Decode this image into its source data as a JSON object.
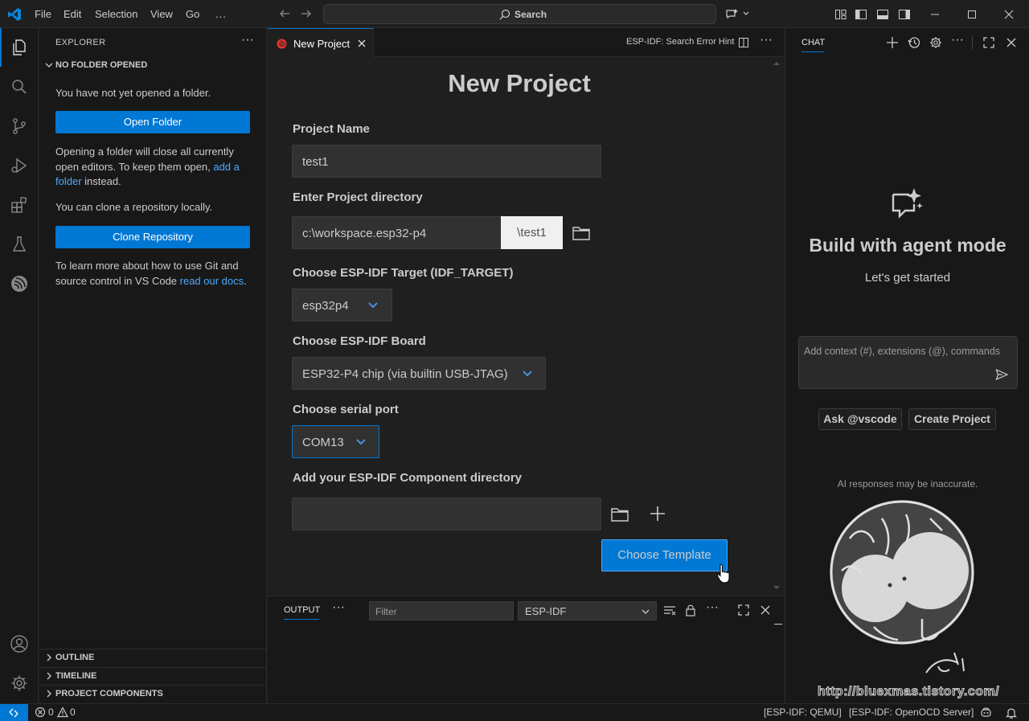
{
  "menu": [
    "File",
    "Edit",
    "Selection",
    "View",
    "Go",
    "..."
  ],
  "search_label": "Search",
  "sidebar": {
    "title": "EXPLORER",
    "section": "NO FOLDER OPENED",
    "intro": "You have not yet opened a folder.",
    "open_folder": "Open Folder",
    "note_before": "Opening a folder will close all currently open editors. To keep them open, ",
    "note_link": "add a folder",
    "note_after": " instead.",
    "clone_text": "You can clone a repository locally.",
    "clone_button": "Clone Repository",
    "git_before": "To learn more about how to use Git and source control in VS Code ",
    "git_link": "read our docs",
    "git_after": ".",
    "bottom_sections": [
      "OUTLINE",
      "TIMELINE",
      "PROJECT COMPONENTS"
    ]
  },
  "tab": {
    "label": "New Project"
  },
  "hint": "ESP-IDF: Search Error Hint",
  "form": {
    "title": "New Project",
    "project_name_label": "Project Name",
    "project_name_value": "test1",
    "directory_label": "Enter Project directory",
    "directory_value": "c:\\workspace.esp32-p4",
    "directory_suffix": "\\test1",
    "target_label": "Choose ESP-IDF Target (IDF_TARGET)",
    "target_value": "esp32p4",
    "board_label": "Choose ESP-IDF Board",
    "board_value": "ESP32-P4 chip (via builtin USB-JTAG)",
    "port_label": "Choose serial port",
    "port_value": "COM13",
    "component_label": "Add your ESP-IDF Component directory",
    "component_value": "",
    "template_button": "Choose Template"
  },
  "panel": {
    "tab": "OUTPUT",
    "filter_placeholder": "Filter",
    "channel": "ESP-IDF"
  },
  "chat": {
    "title": "CHAT",
    "headline": "Build with agent mode",
    "subtitle": "Let's get started",
    "input_placeholder": "Add context (#), extensions (@), commands",
    "chips": [
      "Ask @vscode",
      "Create Project"
    ],
    "disclaimer": "AI responses may be inaccurate.",
    "watermark": "http://bluexmas.tistory.com/"
  },
  "status": {
    "problems": "0",
    "warnings": "0",
    "qemu": "[ESP-IDF: QEMU]",
    "openocd": "[ESP-IDF: OpenOCD Server]"
  },
  "colors": {
    "accent": "#0078d4",
    "background": "#1f1f1f",
    "sidebar": "#181818"
  }
}
